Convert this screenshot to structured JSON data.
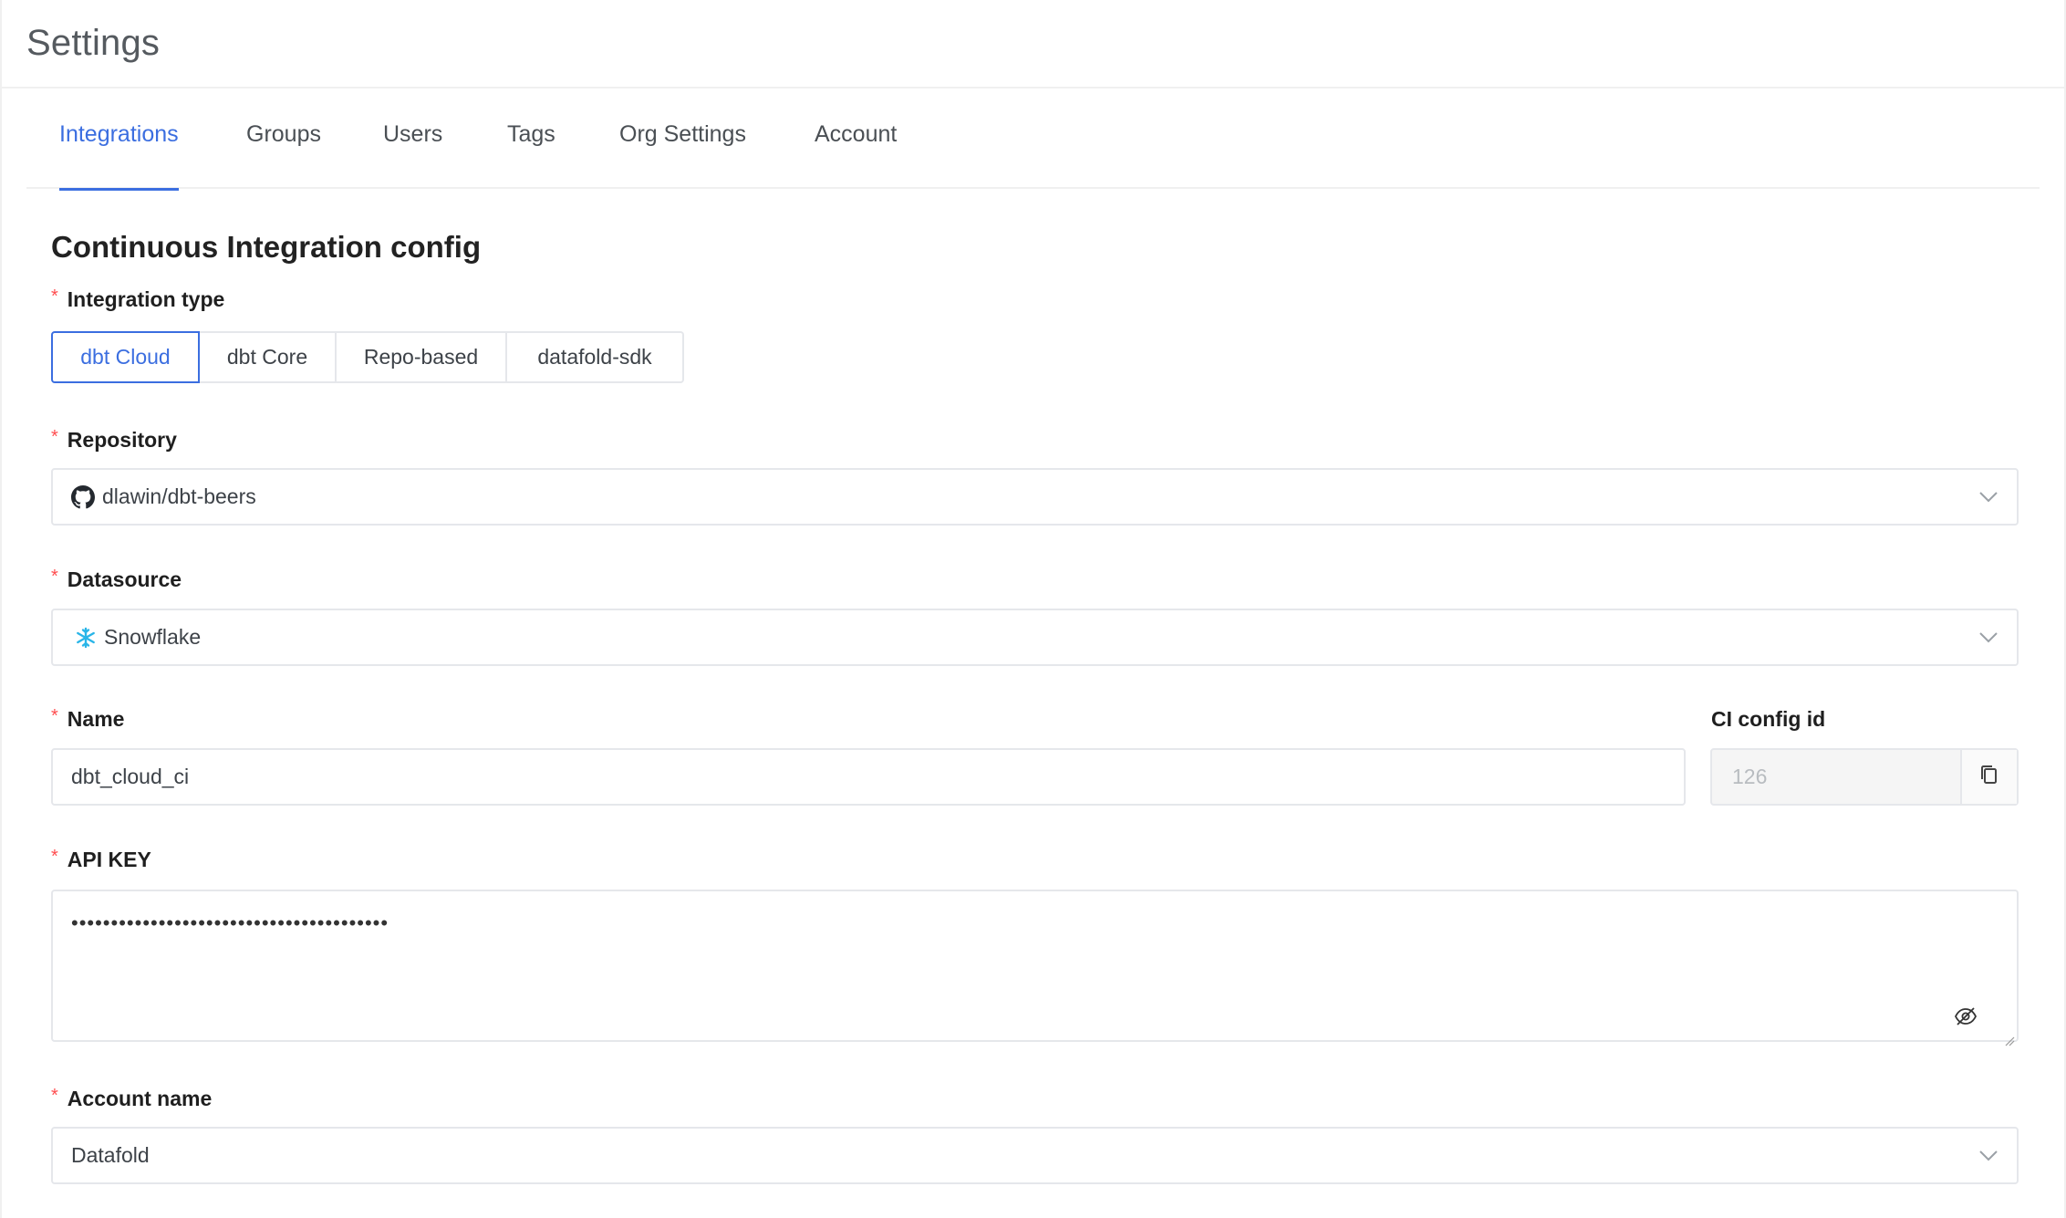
{
  "page": {
    "title": "Settings"
  },
  "tabs": [
    {
      "label": "Integrations",
      "active": true
    },
    {
      "label": "Groups"
    },
    {
      "label": "Users"
    },
    {
      "label": "Tags"
    },
    {
      "label": "Org Settings"
    },
    {
      "label": "Account"
    }
  ],
  "form": {
    "title": "Continuous Integration config",
    "integration_type": {
      "label": "Integration type",
      "required": "*",
      "options": [
        "dbt Cloud",
        "dbt Core",
        "Repo-based",
        "datafold-sdk"
      ],
      "selected": "dbt Cloud"
    },
    "repository": {
      "label": "Repository",
      "required": "*",
      "value": "dlawin/dbt-beers",
      "icon": "github-icon"
    },
    "datasource": {
      "label": "Datasource",
      "required": "*",
      "value": "Snowflake",
      "icon": "snowflake-icon"
    },
    "name": {
      "label": "Name",
      "required": "*",
      "value": "dbt_cloud_ci"
    },
    "ci_config_id": {
      "label": "CI config id",
      "value": "126",
      "icon": "copy-icon"
    },
    "api_key": {
      "label": "API KEY",
      "required": "*",
      "value": "••••••••••••••••••••••••••••••••••••••••",
      "icon": "eye-slash-icon"
    },
    "account_name": {
      "label": "Account name",
      "required": "*",
      "value": "Datafold"
    }
  },
  "colors": {
    "accent": "#3b6ee0",
    "required": "#ff4d4f",
    "snowflake": "#29b5e8",
    "border": "#e5e7eb"
  }
}
